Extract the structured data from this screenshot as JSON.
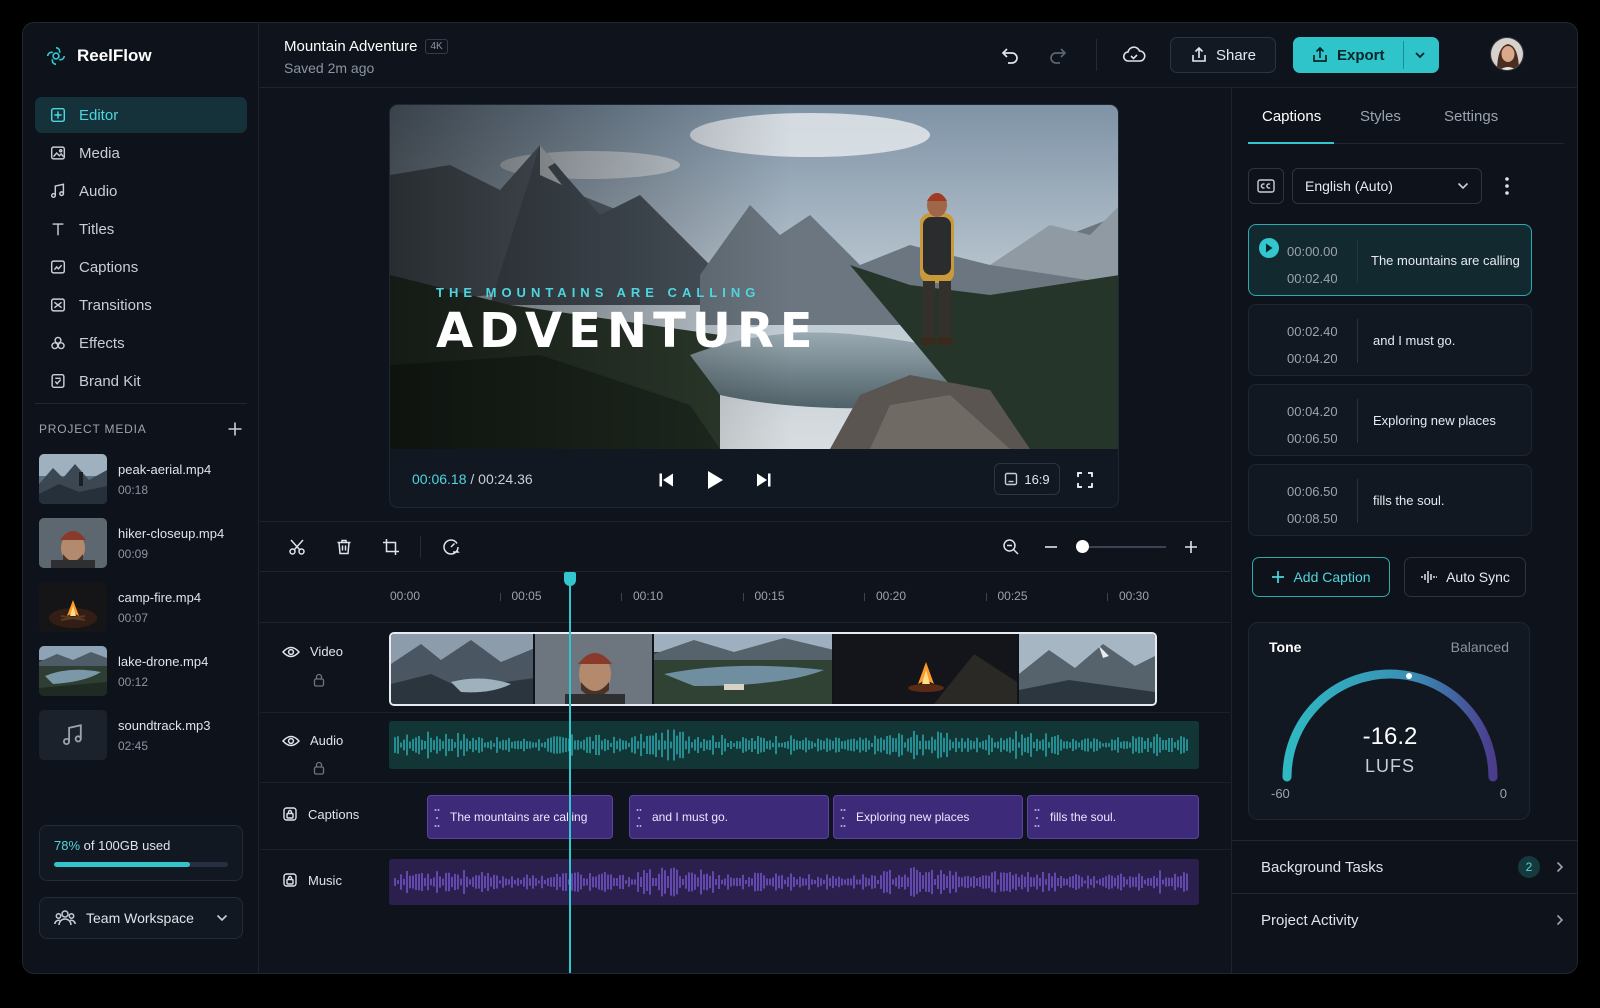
{
  "app": {
    "name": "ReelFlow",
    "brand_color": "#34c6cf"
  },
  "sidebar": {
    "items": [
      {
        "label": "Editor",
        "icon": "editor-icon",
        "active": true
      },
      {
        "label": "Media",
        "icon": "media-icon"
      },
      {
        "label": "Audio",
        "icon": "music-note-icon"
      },
      {
        "label": "Titles",
        "icon": "text-icon"
      },
      {
        "label": "Captions",
        "icon": "captions-icon"
      },
      {
        "label": "Transitions",
        "icon": "transitions-icon"
      },
      {
        "label": "Effects",
        "icon": "effects-icon"
      },
      {
        "label": "Brand Kit",
        "icon": "brand-kit-icon"
      }
    ],
    "project_media": {
      "heading": "PROJECT MEDIA",
      "items": [
        {
          "name": "peak-aerial.mp4",
          "duration": "00:18"
        },
        {
          "name": "hiker-closeup.mp4",
          "duration": "00:09"
        },
        {
          "name": "camp-fire.mp4",
          "duration": "00:07"
        },
        {
          "name": "lake-drone.mp4",
          "duration": "00:12"
        },
        {
          "name": "soundtrack.mp3",
          "duration": "02:45"
        }
      ]
    },
    "storage": {
      "percent_label": "78%",
      "suffix": " of 100GB used",
      "fraction": 0.78
    },
    "workspace": "Team Workspace"
  },
  "header": {
    "project_title": "Mountain Adventure",
    "badge": "4K",
    "saved_status": "Saved 2m ago",
    "share_label": "Share",
    "export_label": "Export"
  },
  "preview": {
    "overlay_subtitle": "THE MOUNTAINS ARE CALLING",
    "overlay_title": "ADVENTURE",
    "current_time": "00:06.18",
    "total_time": " / 00:24.36",
    "aspect_ratio": "16:9"
  },
  "timeline": {
    "ruler": [
      "00:00",
      "00:05",
      "00:10",
      "00:15",
      "00:20",
      "00:25",
      "00:30"
    ],
    "tracks": {
      "video": "Video",
      "audio": "Audio",
      "captions": "Captions",
      "music": "Music"
    },
    "caption_clips": [
      "The mountains are calling",
      "and I must go.",
      "Exploring new places",
      "fills the soul."
    ],
    "zoom_fraction": 0.0
  },
  "right_panel": {
    "tabs": [
      "Captions",
      "Styles",
      "Settings"
    ],
    "language": "English (Auto)",
    "captions": [
      {
        "start": "00:00.00",
        "end": "00:02.40",
        "text": "The mountains are calling",
        "active": true
      },
      {
        "start": "00:02.40",
        "end": "00:04.20",
        "text": "and I must go."
      },
      {
        "start": "00:04.20",
        "end": "00:06.50",
        "text": "Exploring new places"
      },
      {
        "start": "00:06.50",
        "end": "00:08.50",
        "text": "fills the soul."
      }
    ],
    "add_caption_label": "Add Caption",
    "auto_sync_label": "Auto Sync",
    "tone": {
      "title": "Tone",
      "state": "Balanced",
      "value": "-16.2",
      "unit": "LUFS",
      "min": "-60",
      "max": "0"
    },
    "background_tasks": {
      "label": "Background Tasks",
      "count": "2"
    },
    "project_activity": {
      "label": "Project Activity"
    }
  }
}
